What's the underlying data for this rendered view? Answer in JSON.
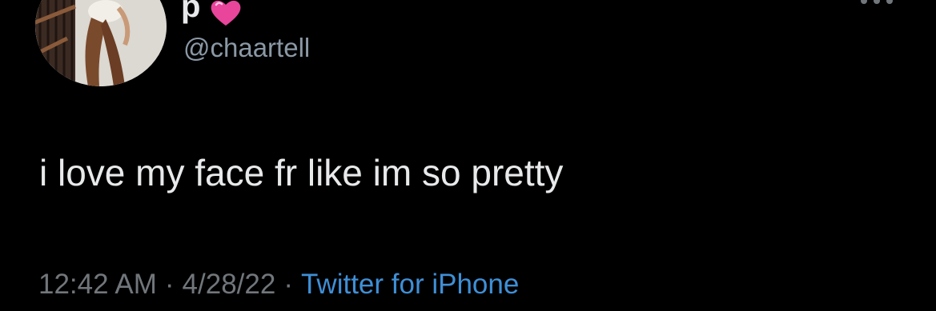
{
  "tweet": {
    "display_name": "p",
    "handle": "@chaartell",
    "text": "i love my face fr like im so pretty",
    "time": "12:42 AM",
    "separator_1": "·",
    "date": "4/28/22",
    "separator_2": "·",
    "source": "Twitter for iPhone"
  },
  "icons": {
    "name_badge": "pink-heart-icon",
    "menu": "more-options-icon"
  },
  "colors": {
    "background": "#000000",
    "primary_text": "#e7e9ea",
    "secondary_text": "#71767b",
    "handle_text": "#8b98a5",
    "link": "#3f8fd6",
    "heart": "#e8459b"
  }
}
